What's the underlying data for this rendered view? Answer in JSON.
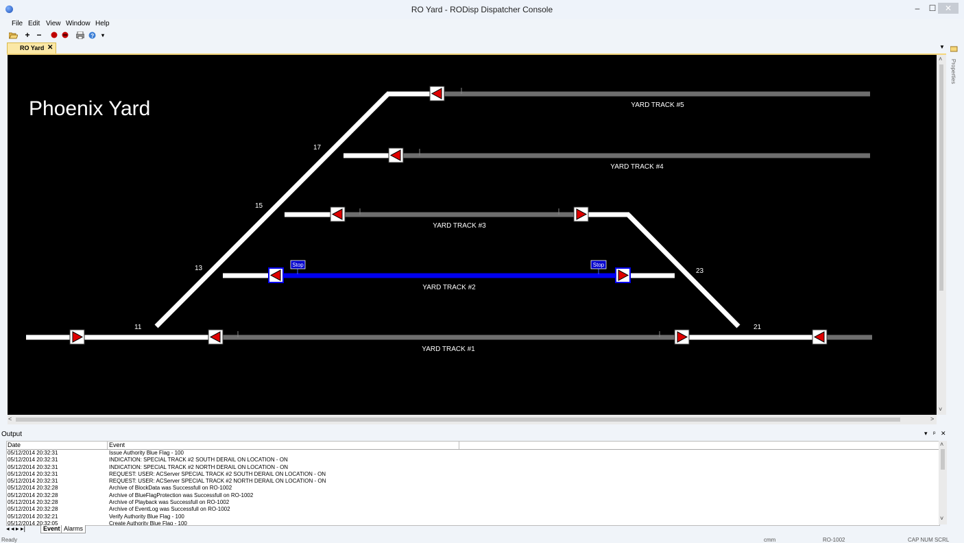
{
  "window": {
    "title": "RO Yard - RODisp Dispatcher Console",
    "minimize": "–",
    "maximize": "☐",
    "close": "✕"
  },
  "menu": {
    "items": [
      "File",
      "Edit",
      "View",
      "Window",
      "Help"
    ]
  },
  "toolbar": {
    "icons": [
      "open-folder-icon",
      "zoom-in-icon",
      "zoom-out-icon",
      "record-icon",
      "stop-icon",
      "print-icon",
      "help-icon"
    ]
  },
  "tab": {
    "label": "RO Yard",
    "close": "✕"
  },
  "properties_panel": {
    "label": "Properties"
  },
  "diagram": {
    "title": "Phoenix Yard",
    "tracks": [
      "YARD TRACK #5",
      "YARD TRACK #4",
      "YARD TRACK #3",
      "YARD TRACK #2",
      "YARD TRACK #1"
    ],
    "switch_labels": [
      "17",
      "15",
      "13",
      "11",
      "23",
      "21"
    ],
    "stop_flags": [
      "Stop",
      "Stop"
    ],
    "colors": {
      "background": "#000000",
      "active_track": "#ffffff",
      "idle_track": "#6e6e6e",
      "route": "#0000ee",
      "signal": "#e00000"
    }
  },
  "output": {
    "title": "Output",
    "controls": [
      "▾",
      "ᵖ",
      "✕"
    ],
    "columns": [
      "Date",
      "Event"
    ],
    "rows": [
      {
        "date": "05/12/2014 20:32:31",
        "event": "Issue Authority Blue Flag - 100"
      },
      {
        "date": "05/12/2014 20:32:31",
        "event": "INDICATION: SPECIAL TRACK #2 SOUTH DERAIL ON LOCATION  - ON"
      },
      {
        "date": "05/12/2014 20:32:31",
        "event": "INDICATION: SPECIAL TRACK #2 NORTH DERAIL ON LOCATION  - ON"
      },
      {
        "date": "05/12/2014 20:32:31",
        "event": "REQUEST: USER: ACServer SPECIAL TRACK #2 SOUTH DERAIL ON LOCATION  - ON"
      },
      {
        "date": "05/12/2014 20:32:31",
        "event": "REQUEST: USER: ACServer SPECIAL TRACK #2 NORTH DERAIL ON LOCATION  - ON"
      },
      {
        "date": "05/12/2014 20:32:28",
        "event": "Archive of BlockData was Successfull on RO-1002"
      },
      {
        "date": "05/12/2014 20:32:28",
        "event": "Archive of BlueFlagProtection was Successfull on RO-1002"
      },
      {
        "date": "05/12/2014 20:32:28",
        "event": "Archive of Playback was Successfull on RO-1002"
      },
      {
        "date": "05/12/2014 20:32:28",
        "event": "Archive of EventLog was Successfull on RO-1002"
      },
      {
        "date": "05/12/2014 20:32:21",
        "event": "Verify Authority Blue Flag - 100"
      },
      {
        "date": "05/12/2014 20:32:05",
        "event": "Create Authority Blue Flag - 100"
      }
    ],
    "nav_arrows": "◂ ◂ ▸ ▸|",
    "tabs": [
      "Event",
      "Alarms"
    ]
  },
  "status": {
    "left": "Ready",
    "user": "cmm",
    "server": "RO-1002",
    "keys": "CAP  NUM  SCRL"
  }
}
